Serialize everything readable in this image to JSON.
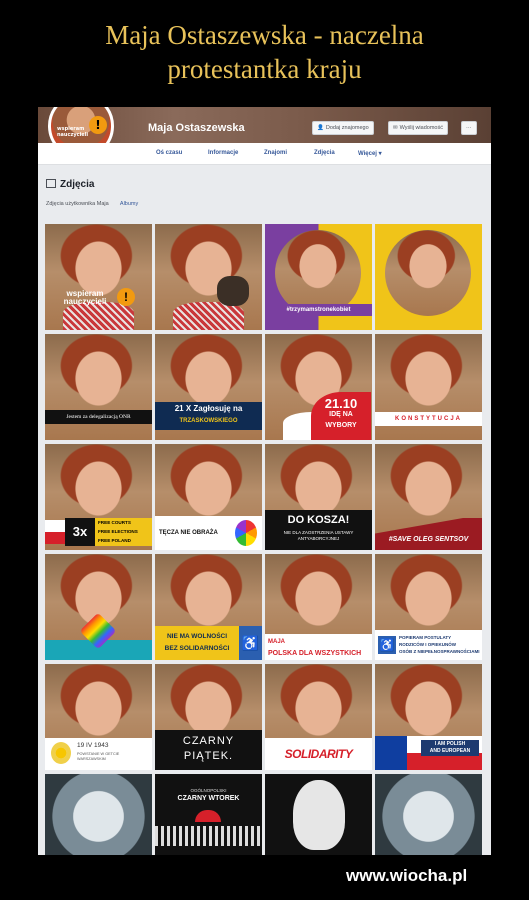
{
  "meme": {
    "title_line1": "Maja Ostaszewska - naczelna",
    "title_line2": "protestantka kraju",
    "watermark": "www.wiocha.pl"
  },
  "profile": {
    "name": "Maja Ostaszewska",
    "pic_label": "wspieram nauczycieli",
    "pic_badge": "!",
    "add_friend": "Dodaj znajomego",
    "message": "Wyślij wiadomość",
    "more": "···"
  },
  "nav": {
    "items": [
      "Oś czasu",
      "Informacje",
      "Znajomi",
      "Zdjęcia",
      "Więcej ▾"
    ]
  },
  "photos": {
    "heading": "Zdjęcia",
    "tab_user": "Zdjęcia użytkownika Maja",
    "tab_albums": "Albumy"
  },
  "tiles": {
    "t1": "wspieram nauczycieli",
    "t1_badge": "!",
    "t3": "#trzymamstronekobiet",
    "t5": "Jestem za delegalizacją ONR",
    "t6a": "21 X Zagłosuję na",
    "t6b": "TRZASKOWSKIEGO",
    "t7a": "21.10",
    "t7b": "IDĘ NA",
    "t7c": "WYBORY",
    "t8": "KONSTYTUCJA",
    "t9a": "3x",
    "t9b": "FREE COURTS",
    "t9c": "FREE ELECTIONS",
    "t9d": "FREE POLAND",
    "t10": "TĘCZA NIE OBRAŻA",
    "t11a": "DO KOSZA!",
    "t11b": "NIE DLA ZAOSTRZENIA USTAWY ANTYABORCYJNEJ",
    "t12": "#SAVE OLEG SENTSOV",
    "t14a": "NIE MA WOLNOŚCI",
    "t14b": "BEZ SOLIDARNOŚCI",
    "t15a": "MAJA",
    "t15b": "POLSKA DLA WSZYSTKICH",
    "t16a": "POPIERAM POSTULATY",
    "t16b": "RODZICÓW I OPIEKUNÓW",
    "t16c": "OSÓB Z NIEPEŁNOSPRAWNOŚCIAMI",
    "t17a": "19 IV 1943",
    "t17b": "POWSTANIE W GETCIE WARSZAWSKIM",
    "t18a": "CZARNY",
    "t18b": "PIĄTEK.",
    "t19": "SOLIDARITY",
    "t20a": "I AM POLISH",
    "t20b": "AND EUROPEAN",
    "t22a": "OGÓLNOPOLSKI",
    "t22b": "CZARNY WTOREK"
  },
  "colors": {
    "title_gold": "#e8c25a",
    "fb_link": "#365899",
    "fb_bg": "#e9ebee",
    "orange_badge": "#f29a10",
    "yellow": "#f0c419",
    "violet": "#7a3fa0",
    "red": "#d6202a",
    "navy": "#0f2b52"
  }
}
